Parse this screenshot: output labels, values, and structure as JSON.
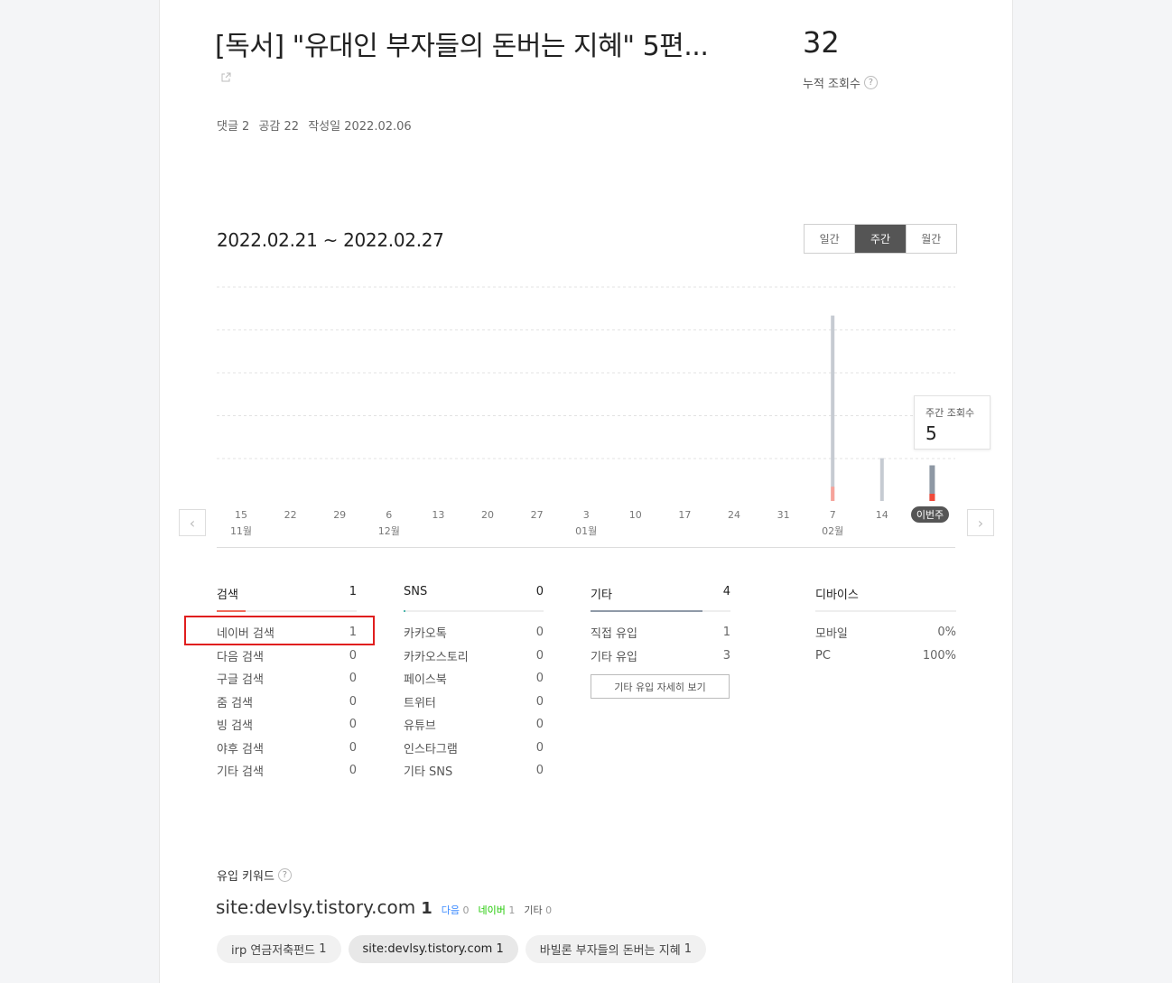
{
  "post": {
    "title": "[독서] \"유대인 부자들의 돈버는 지혜\" 5편...",
    "meta": {
      "comments": "댓글 2",
      "likes": "공감 22",
      "date": "작성일 2022.02.06"
    },
    "total_views": "32",
    "total_views_label": "누적 조회수"
  },
  "period": {
    "range": "2022.02.21 ~ 2022.02.27",
    "tabs": [
      {
        "label": "일간"
      },
      {
        "label": "주간"
      },
      {
        "label": "월간"
      }
    ],
    "selected": "주간"
  },
  "chart_data": {
    "type": "bar",
    "title": "",
    "categories": [
      "15",
      "22",
      "29",
      "6",
      "13",
      "20",
      "27",
      "3",
      "10",
      "17",
      "24",
      "31",
      "7",
      "14",
      "이번주"
    ],
    "month_labels": [
      {
        "at": "15",
        "label": "11월"
      },
      {
        "at": "6",
        "label": "12월"
      },
      {
        "at": "3",
        "label": "01월"
      },
      {
        "at": "7",
        "label": "02월"
      }
    ],
    "series": [
      {
        "values": [
          0,
          0,
          0,
          0,
          0,
          0,
          0,
          0,
          0,
          0,
          0,
          0,
          26,
          6,
          5
        ],
        "color": "#c6cbd2"
      },
      {
        "values": [
          0,
          0,
          0,
          0,
          0,
          0,
          0,
          0,
          0,
          0,
          0,
          0,
          2,
          0,
          1
        ],
        "color": "#f06a5a"
      }
    ],
    "ylim": [
      0,
      30
    ],
    "grid": true,
    "tooltip": {
      "label": "주간 조회수",
      "value": "5"
    },
    "current_label": "이번주"
  },
  "stats": {
    "search": {
      "title": "검색",
      "total": "1",
      "rows": [
        {
          "label": "네이버 검색",
          "value": "1"
        },
        {
          "label": "다음 검색",
          "value": "0"
        },
        {
          "label": "구글 검색",
          "value": "0"
        },
        {
          "label": "줌 검색",
          "value": "0"
        },
        {
          "label": "빙 검색",
          "value": "0"
        },
        {
          "label": "야후 검색",
          "value": "0"
        },
        {
          "label": "기타 검색",
          "value": "0"
        }
      ]
    },
    "sns": {
      "title": "SNS",
      "total": "0",
      "rows": [
        {
          "label": "카카오톡",
          "value": "0"
        },
        {
          "label": "카카오스토리",
          "value": "0"
        },
        {
          "label": "페이스북",
          "value": "0"
        },
        {
          "label": "트위터",
          "value": "0"
        },
        {
          "label": "유튜브",
          "value": "0"
        },
        {
          "label": "인스타그램",
          "value": "0"
        },
        {
          "label": "기타 SNS",
          "value": "0"
        }
      ]
    },
    "etc": {
      "title": "기타",
      "total": "4",
      "rows": [
        {
          "label": "직접 유입",
          "value": "1"
        },
        {
          "label": "기타 유입",
          "value": "3"
        }
      ],
      "detail_button": "기타 유입 자세히 보기"
    },
    "device": {
      "title": "디바이스",
      "rows": [
        {
          "label": "모바일",
          "value": "0%"
        },
        {
          "label": "PC",
          "value": "100%"
        }
      ]
    }
  },
  "keywords": {
    "label": "유입 키워드",
    "main": "site:devlsy.tistory.com",
    "main_count": "1",
    "sources": {
      "daum": "다음",
      "daum_count": "0",
      "naver": "네이버",
      "naver_count": "1",
      "etc": "기타",
      "etc_count": "0"
    },
    "chips": [
      {
        "label": "irp 연금저축펀드",
        "count": "1"
      },
      {
        "label": "site:devlsy.tistory.com",
        "count": "1"
      },
      {
        "label": "바빌론 부자들의 돈버는 지혜",
        "count": "1"
      }
    ]
  },
  "colors": {
    "accent": "#f06a5a",
    "selected_tab": "#555555",
    "highlight_box": "#e01e1e",
    "sns_bar": "#4db6ac",
    "etc_bar": "#8f9aa7",
    "daum": "#3f8cff",
    "naver": "#1ec800"
  }
}
